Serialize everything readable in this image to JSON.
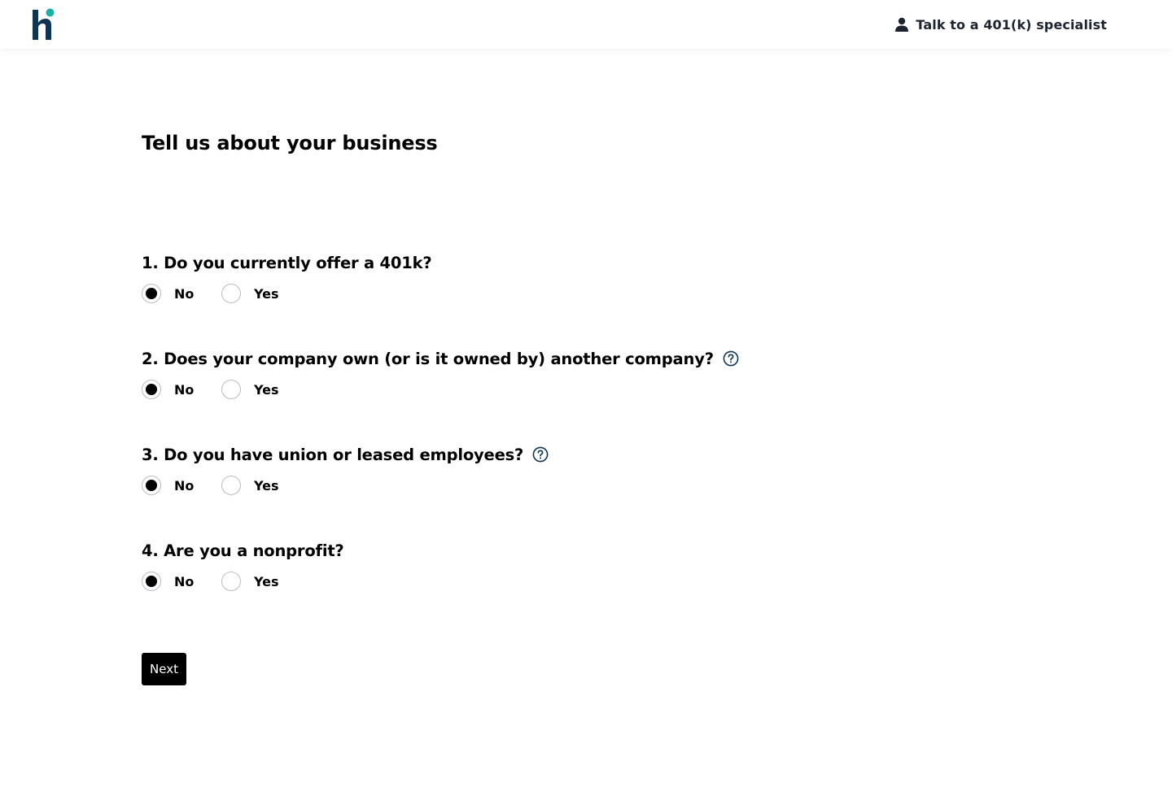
{
  "header": {
    "logo_icon": "guideline-h-logo",
    "brand_colors": {
      "primary": "#0e3552",
      "accent": "#1ab0a8"
    },
    "specialist_icon": "person-icon",
    "specialist_label": "Talk to a 401(k) specialist"
  },
  "page": {
    "title": "Tell us about your business"
  },
  "questions": [
    {
      "text": "1. Do you currently offer a 401k?",
      "has_help": false,
      "options": [
        "No",
        "Yes"
      ],
      "selected": "No"
    },
    {
      "text": "2. Does your company own (or is it owned by) another company?",
      "has_help": true,
      "options": [
        "No",
        "Yes"
      ],
      "selected": "No"
    },
    {
      "text": "3. Do you have union or leased employees?",
      "has_help": true,
      "options": [
        "No",
        "Yes"
      ],
      "selected": "No"
    },
    {
      "text": "4. Are you a nonprofit?",
      "has_help": false,
      "options": [
        "No",
        "Yes"
      ],
      "selected": "No"
    }
  ],
  "help_icon": "question-circle-icon",
  "next_label": "Next"
}
